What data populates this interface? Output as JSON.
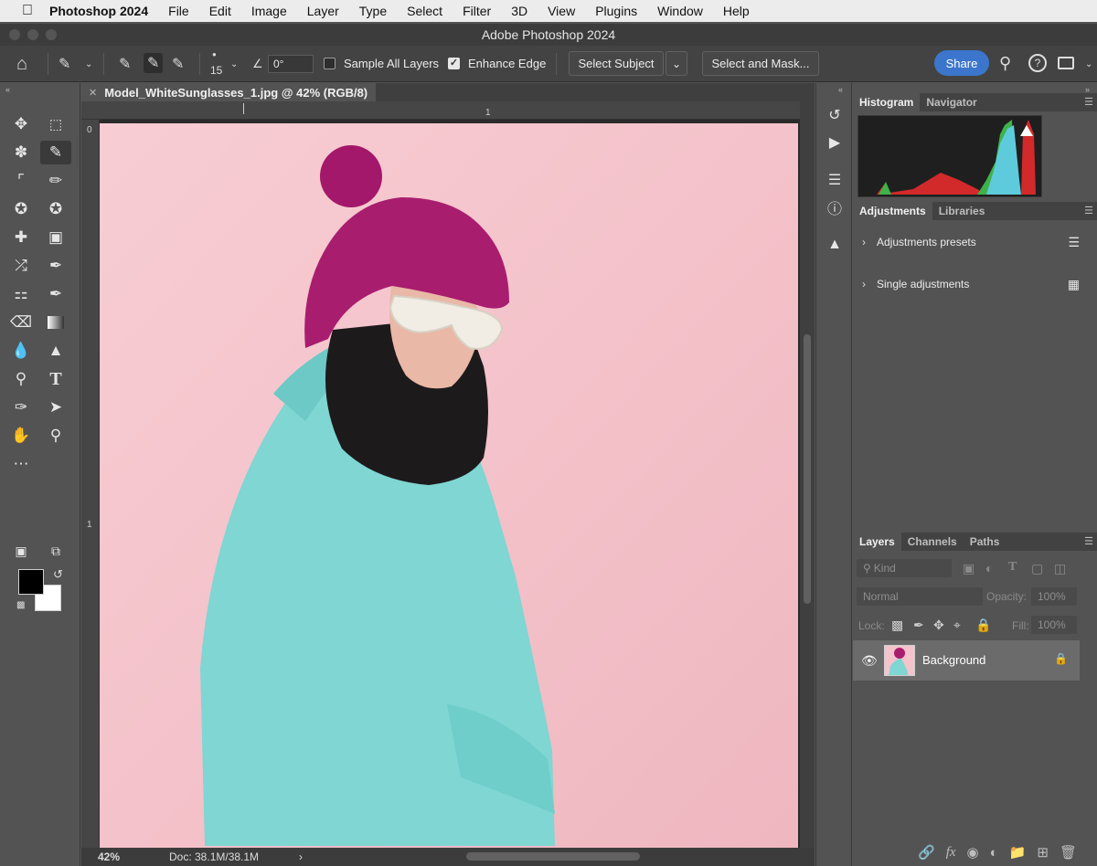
{
  "menubar": {
    "app_name": "Photoshop 2024",
    "items": [
      "File",
      "Edit",
      "Image",
      "Layer",
      "Type",
      "Select",
      "Filter",
      "3D",
      "View",
      "Plugins",
      "Window",
      "Help"
    ]
  },
  "window": {
    "title": "Adobe Photoshop 2024"
  },
  "options_bar": {
    "brush_size": "15",
    "angle": "0°",
    "sample_all_layers": {
      "label": "Sample All Layers",
      "checked": false
    },
    "enhance_edge": {
      "label": "Enhance Edge",
      "checked": true
    },
    "select_subject": "Select Subject",
    "select_and_mask": "Select and Mask...",
    "share": "Share"
  },
  "document": {
    "tab_title": "Model_WhiteSunglasses_1.jpg @ 42% (RGB/8)",
    "ruler_top_marks": [
      "1"
    ],
    "ruler_left_marks": [
      "0",
      "1"
    ],
    "zoom": "42%",
    "doc_size": "Doc: 38.1M/38.1M"
  },
  "panels": {
    "top_tabs": [
      "Histogram",
      "Navigator"
    ],
    "adjust_tabs": [
      "Adjustments",
      "Libraries"
    ],
    "adjustments": [
      "Adjustments presets",
      "Single adjustments"
    ],
    "layer_tabs": [
      "Layers",
      "Channels",
      "Paths"
    ],
    "layers_filter": "Kind",
    "blend_mode": "Normal",
    "opacity_label": "Opacity:",
    "opacity_value": "100%",
    "lock_label": "Lock:",
    "fill_label": "Fill:",
    "fill_value": "100%",
    "layers": [
      {
        "name": "Background",
        "visible": true,
        "locked": true
      }
    ]
  },
  "colors": {
    "accent": "#3b76cc",
    "canvas_bg": "#f4c7cf",
    "ui_bg": "#535353"
  }
}
